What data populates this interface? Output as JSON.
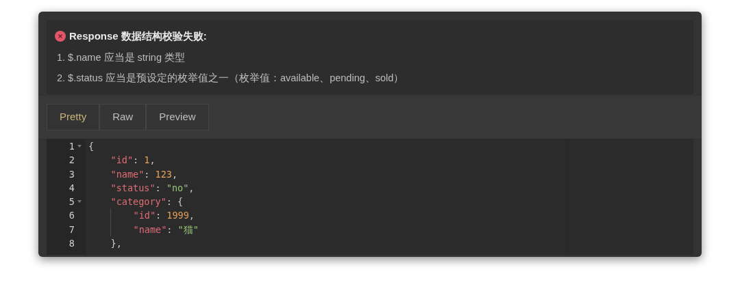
{
  "error": {
    "title": "Response 数据结构校验失败:",
    "items": [
      "1. $.name 应当是 string 类型",
      "2. $.status 应当是预设定的枚举值之一（枚举值：available、pending、sold）"
    ]
  },
  "tabs": [
    {
      "label": "Pretty",
      "selected": true
    },
    {
      "label": "Raw",
      "selected": false
    },
    {
      "label": "Preview",
      "selected": false
    }
  ],
  "code": [
    {
      "number": "1",
      "foldable": true,
      "guide": false,
      "tokens": [
        {
          "kind": "punct",
          "text": "{"
        }
      ]
    },
    {
      "number": "2",
      "foldable": false,
      "guide": false,
      "tokens": [
        {
          "kind": "key",
          "text": "    \"id\""
        },
        {
          "kind": "punct",
          "text": ": "
        },
        {
          "kind": "number",
          "text": "1"
        },
        {
          "kind": "punct",
          "text": ","
        }
      ]
    },
    {
      "number": "3",
      "foldable": false,
      "guide": false,
      "tokens": [
        {
          "kind": "key",
          "text": "    \"name\""
        },
        {
          "kind": "punct",
          "text": ": "
        },
        {
          "kind": "number",
          "text": "123"
        },
        {
          "kind": "punct",
          "text": ","
        }
      ]
    },
    {
      "number": "4",
      "foldable": false,
      "guide": false,
      "tokens": [
        {
          "kind": "key",
          "text": "    \"status\""
        },
        {
          "kind": "punct",
          "text": ": "
        },
        {
          "kind": "string",
          "text": "\"no\""
        },
        {
          "kind": "punct",
          "text": ","
        }
      ]
    },
    {
      "number": "5",
      "foldable": true,
      "guide": false,
      "tokens": [
        {
          "kind": "key",
          "text": "    \"category\""
        },
        {
          "kind": "punct",
          "text": ": {"
        }
      ]
    },
    {
      "number": "6",
      "foldable": false,
      "guide": true,
      "tokens": [
        {
          "kind": "key",
          "text": "    \"id\""
        },
        {
          "kind": "punct",
          "text": ": "
        },
        {
          "kind": "number",
          "text": "1999"
        },
        {
          "kind": "punct",
          "text": ","
        }
      ]
    },
    {
      "number": "7",
      "foldable": false,
      "guide": true,
      "tokens": [
        {
          "kind": "key",
          "text": "    \"name\""
        },
        {
          "kind": "punct",
          "text": ": "
        },
        {
          "kind": "string",
          "text": "\"猫\""
        }
      ]
    },
    {
      "number": "8",
      "foldable": false,
      "guide": false,
      "tokens": [
        {
          "kind": "punct",
          "text": "    },"
        }
      ]
    }
  ]
}
